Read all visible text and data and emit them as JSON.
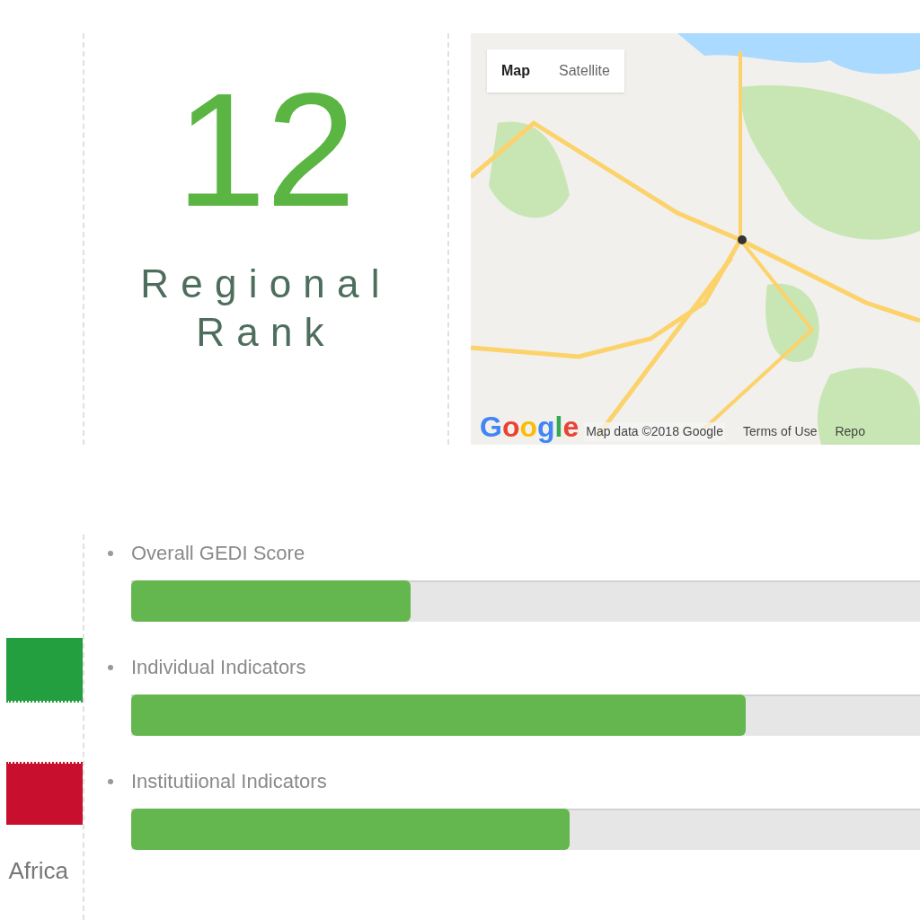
{
  "rank": {
    "value": "12",
    "label": "Regional Rank"
  },
  "map": {
    "map_types": [
      {
        "label": "Map",
        "selected": true
      },
      {
        "label": "Satellite",
        "selected": false
      }
    ],
    "logo": "Google",
    "attribution": "Map data ©2018 Google",
    "terms": "Terms of Use",
    "report": "Repo"
  },
  "region": "Africa",
  "indicators": [
    {
      "label": "Overall GEDI Score",
      "level": 0.35
    },
    {
      "label": "Individual Indicators",
      "level": 0.77
    },
    {
      "label": "Institutiional Indicators",
      "level": 0.55
    }
  ]
}
